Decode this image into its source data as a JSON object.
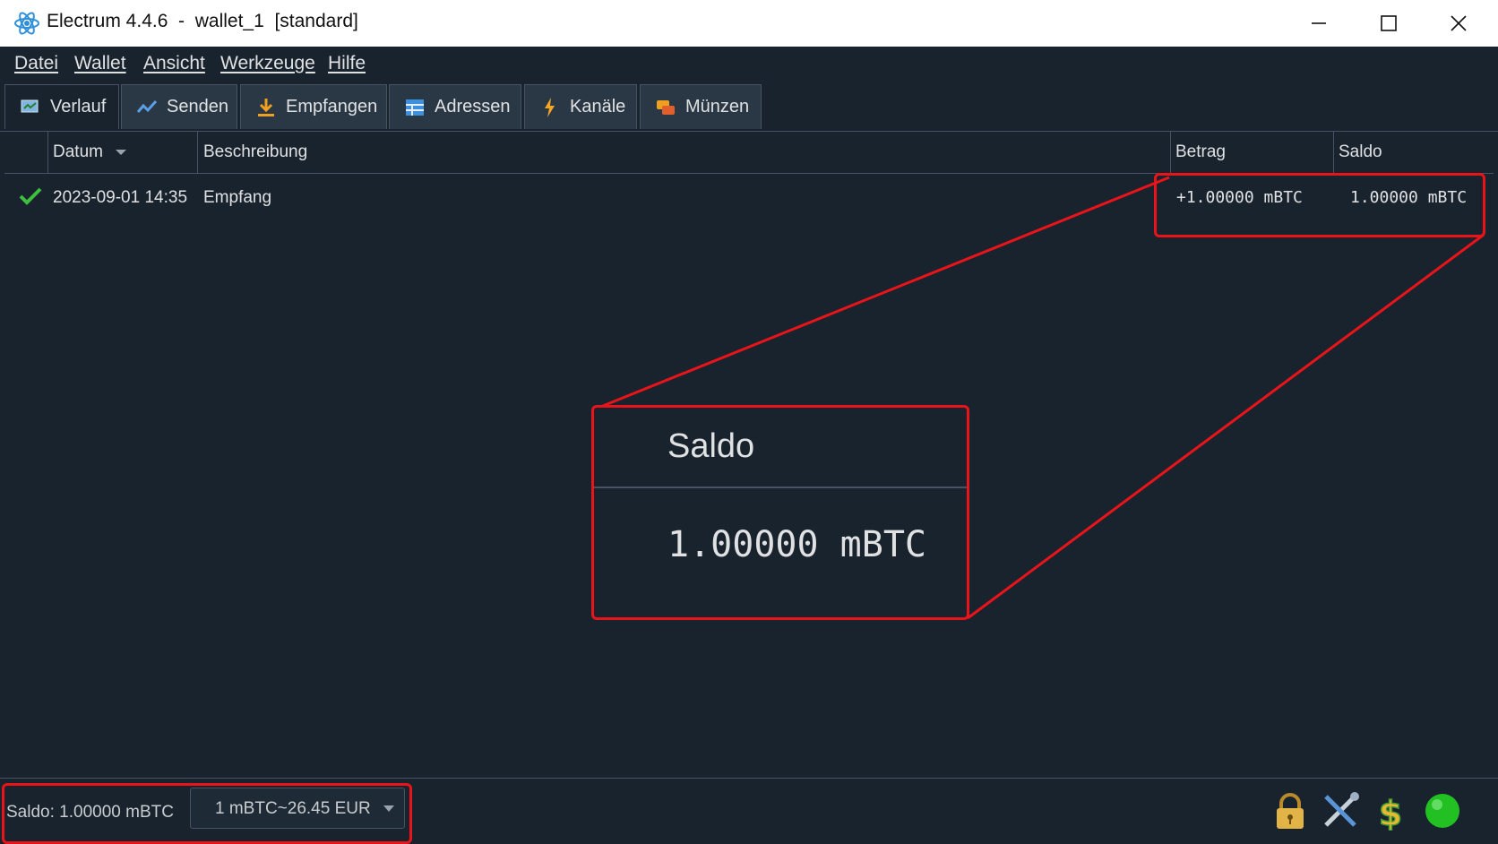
{
  "window": {
    "title": "Electrum 4.4.6  -  wallet_1  [standard]",
    "icons": {
      "app": "electrum-atom-icon",
      "minimize": "minimize-icon",
      "maximize": "maximize-icon",
      "close": "close-icon"
    }
  },
  "menu": [
    "Datei",
    "Wallet",
    "Ansicht",
    "Werkzeuge",
    "Hilfe"
  ],
  "tabs": [
    {
      "label": "Verlauf",
      "icon": "history-icon",
      "active": true
    },
    {
      "label": "Senden",
      "icon": "send-icon",
      "active": false
    },
    {
      "label": "Empfangen",
      "icon": "receive-icon",
      "active": false
    },
    {
      "label": "Adressen",
      "icon": "addresses-icon",
      "active": false
    },
    {
      "label": "Kanäle",
      "icon": "lightning-icon",
      "active": false
    },
    {
      "label": "Münzen",
      "icon": "coins-icon",
      "active": false
    }
  ],
  "table": {
    "columns": {
      "date": "Datum",
      "description": "Beschreibung",
      "amount": "Betrag",
      "balance": "Saldo"
    },
    "sort_indicator": "sort-descending-icon",
    "rows": [
      {
        "status": "confirmed-check-icon",
        "date": "2023-09-01 14:35",
        "description": "Empfang",
        "amount": "+1.00000 mBTC",
        "balance": "1.00000 mBTC"
      }
    ]
  },
  "callout": {
    "heading": "Saldo",
    "value": "1.00000 mBTC"
  },
  "status": {
    "balance": "Saldo: 1.00000 mBTC",
    "rate": "1 mBTC~26.45 EUR",
    "icons": [
      "lock-icon",
      "tools-icon",
      "dollar-icon",
      "network-status-icon"
    ]
  },
  "colors": {
    "background": "#19232d",
    "highlight": "#e8141a",
    "text": "#e0e1e3",
    "check": "#3fbf3f",
    "network_ok": "#22c022"
  }
}
